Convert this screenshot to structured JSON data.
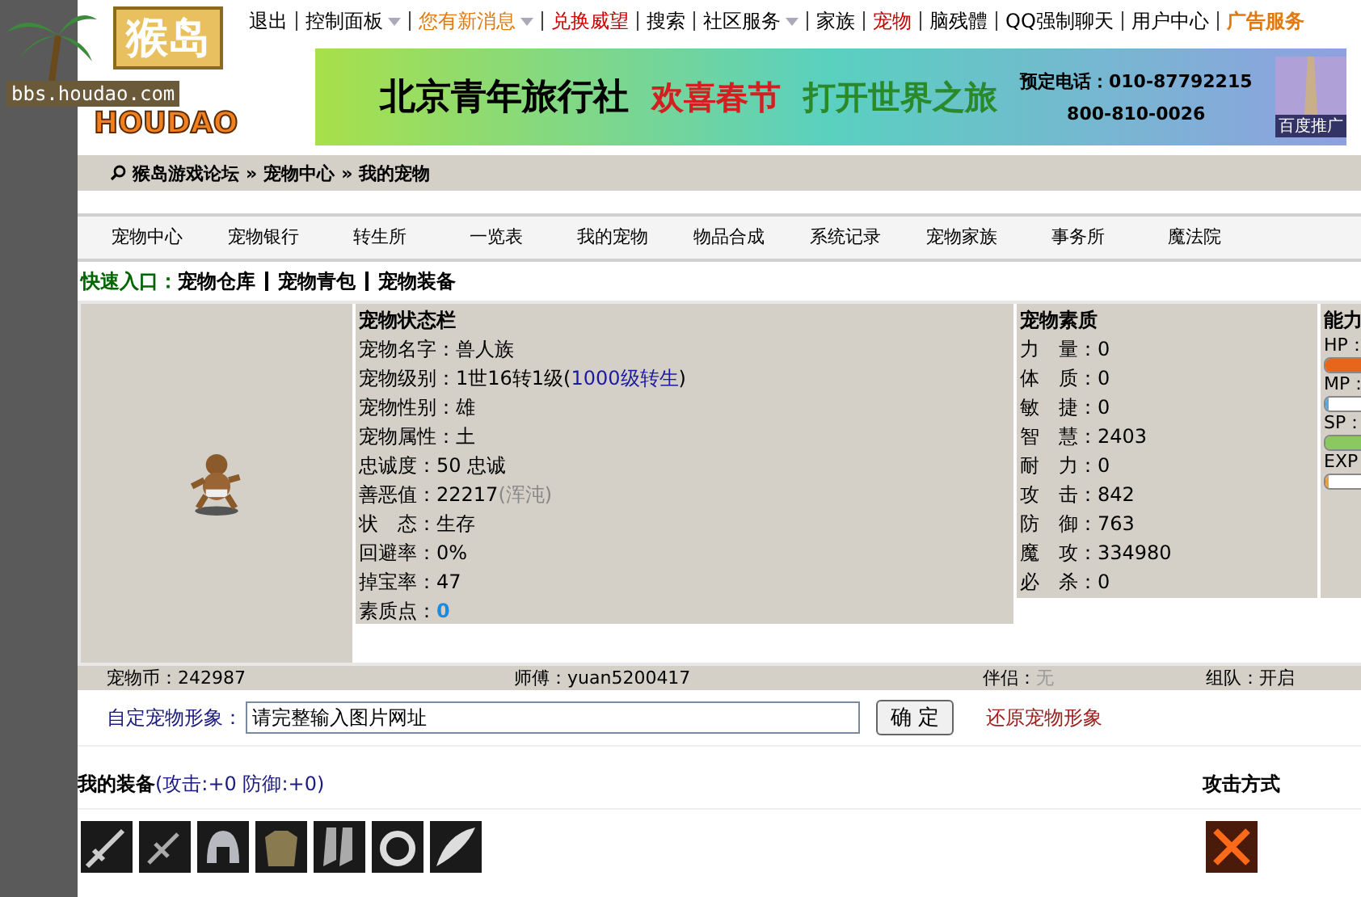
{
  "logo": {
    "title": "猴岛",
    "url": "bbs.houdao.com",
    "brand": "HOUDAO"
  },
  "top_nav": [
    {
      "label": "退出",
      "color": "#000000",
      "dropdown": false
    },
    {
      "label": "控制面板",
      "color": "#000000",
      "dropdown": true
    },
    {
      "label": "您有新消息",
      "color": "#e07a10",
      "dropdown": true
    },
    {
      "label": "兑换威望",
      "color": "#cc0000",
      "dropdown": false
    },
    {
      "label": "搜索",
      "color": "#000000",
      "dropdown": false
    },
    {
      "label": "社区服务",
      "color": "#000000",
      "dropdown": true
    },
    {
      "label": "家族",
      "color": "#000000",
      "dropdown": false
    },
    {
      "label": "宠物",
      "color": "#cc0000",
      "dropdown": false
    },
    {
      "label": "脑残體",
      "color": "#000000",
      "dropdown": false
    },
    {
      "label": "QQ强制聊天",
      "color": "#000000",
      "dropdown": false
    },
    {
      "label": "用户中心",
      "color": "#000000",
      "dropdown": false
    },
    {
      "label": "广告服务",
      "color": "#e07a10",
      "dropdown": false
    }
  ],
  "banner": {
    "company": "北京青年旅行社",
    "slogan_1": "欢喜春节",
    "slogan_2": "打开世界之旅",
    "phone_1": "预定电话：010-87792215",
    "phone_2": "800-810-0026",
    "badge": "百度推广"
  },
  "breadcrumb": {
    "separator": "»",
    "items": [
      "猴岛游戏论坛",
      "宠物中心",
      "我的宠物"
    ]
  },
  "tabs": [
    {
      "label": "宠物中心",
      "selected": false
    },
    {
      "label": "宠物银行",
      "selected": false
    },
    {
      "label": "转生所",
      "selected": false
    },
    {
      "label": "一览表",
      "selected": false
    },
    {
      "label": "我的宠物",
      "selected": false
    },
    {
      "label": "物品合成",
      "selected": false
    },
    {
      "label": "系统记录",
      "selected": false
    },
    {
      "label": "宠物家族",
      "selected": false
    },
    {
      "label": "事务所",
      "selected": false
    },
    {
      "label": "魔法院",
      "selected": false
    }
  ],
  "quick_entry": {
    "label": "快速入口：",
    "links": [
      "宠物仓库",
      "宠物青包",
      "宠物装备"
    ]
  },
  "status_panel": {
    "title": "宠物状态栏",
    "rows": [
      {
        "label": "宠物名字：",
        "parts": [
          {
            "kind": "plain",
            "text": "兽人族"
          }
        ]
      },
      {
        "label": "宠物级别：",
        "parts": [
          {
            "kind": "plain",
            "text": "1世16转1级("
          },
          {
            "kind": "link",
            "text": "1000级转生"
          },
          {
            "kind": "plain",
            "text": ")"
          }
        ]
      },
      {
        "label": "宠物性别：",
        "parts": [
          {
            "kind": "plain",
            "text": "雄"
          }
        ]
      },
      {
        "label": "宠物属性：",
        "parts": [
          {
            "kind": "plain",
            "text": "土"
          }
        ]
      },
      {
        "label": "忠诚度：",
        "parts": [
          {
            "kind": "plain",
            "text": "50 忠诚"
          }
        ]
      },
      {
        "label": "善恶值：",
        "parts": [
          {
            "kind": "plain",
            "text": "22217"
          },
          {
            "kind": "muted",
            "text": "(浑沌)"
          }
        ]
      },
      {
        "label": "状　态：",
        "parts": [
          {
            "kind": "plain",
            "text": "生存"
          }
        ]
      },
      {
        "label": "回避率：",
        "parts": [
          {
            "kind": "plain",
            "text": "0%"
          }
        ]
      },
      {
        "label": "掉宝率：",
        "parts": [
          {
            "kind": "plain",
            "text": "47"
          }
        ]
      },
      {
        "label": "素质点：",
        "parts": [
          {
            "kind": "highlight",
            "text": "0"
          }
        ]
      }
    ]
  },
  "quality_panel": {
    "title": "宠物素质",
    "rows": [
      {
        "label": "力　量：",
        "value": "0"
      },
      {
        "label": "体　质：",
        "value": "0"
      },
      {
        "label": "敏　捷：",
        "value": "0"
      },
      {
        "label": "智　慧：",
        "value": "2403"
      },
      {
        "label": "耐　力：",
        "value": "0"
      },
      {
        "label": "攻　击：",
        "value": "842"
      },
      {
        "label": "防　御：",
        "value": "763"
      },
      {
        "label": "魔　攻：",
        "value": "334980"
      },
      {
        "label": "必　杀：",
        "value": "0"
      }
    ]
  },
  "ability_panel": {
    "title": "能力",
    "bars": [
      {
        "label": "HP：",
        "kind": "hp",
        "level": 1
      },
      {
        "label": "MP：",
        "kind": "mp",
        "level": 0.05
      },
      {
        "label": "SP：",
        "kind": "sp",
        "level": 1
      },
      {
        "label": "EXP",
        "kind": "exp",
        "level": 0.05
      }
    ]
  },
  "info_bar": [
    {
      "label": "宠物币：",
      "value": "242987",
      "muted": false
    },
    {
      "label": "师傅：",
      "value": "yuan5200417",
      "muted": false
    },
    {
      "label": "伴侣：",
      "value": "无",
      "muted": true
    },
    {
      "label": "组队：",
      "value": "开启",
      "muted": false
    }
  ],
  "custom_image": {
    "label": "自定宠物形象：",
    "value": "请完整输入图片网址",
    "button": "确 定",
    "restore": "还原宠物形象"
  },
  "equipment": {
    "title": "我的装备",
    "bonus": "(攻击:+0 防御:+0)",
    "attack_title": "攻击方式",
    "items": [
      {
        "kind": "sword"
      },
      {
        "kind": "dagger"
      },
      {
        "kind": "helmet"
      },
      {
        "kind": "armor"
      },
      {
        "kind": "boots"
      },
      {
        "kind": "ring"
      },
      {
        "kind": "wing"
      }
    ]
  }
}
